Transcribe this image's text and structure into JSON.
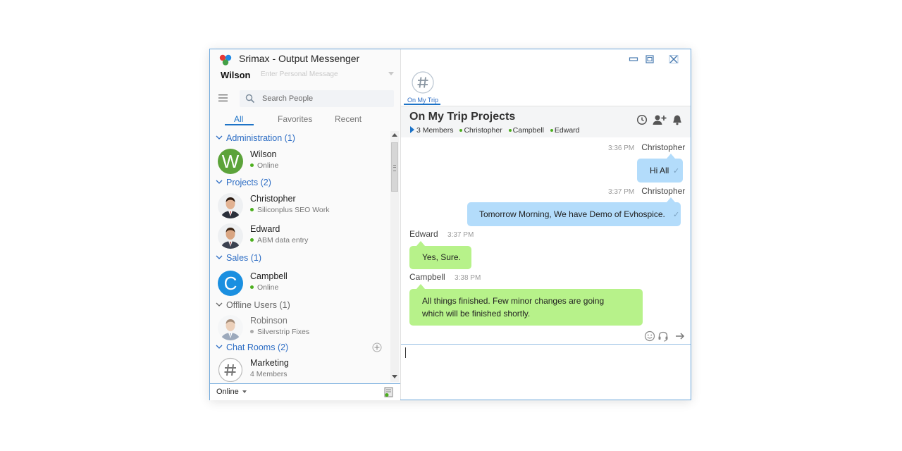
{
  "app": {
    "title": "Srimax - Output Messenger",
    "user_name": "Wilson",
    "personal_message_placeholder": "Enter Personal Message",
    "accent_color": "#1d73c7"
  },
  "search": {
    "placeholder": "Search People"
  },
  "tabs": [
    {
      "label": "All",
      "active": true
    },
    {
      "label": "Favorites",
      "active": false
    },
    {
      "label": "Recent",
      "active": false
    }
  ],
  "groups": [
    {
      "label": "Administration (1)",
      "contacts": [
        {
          "name": "Wilson",
          "status": "Online",
          "avatar_letter": "W",
          "avatar_color": "#5ca33a"
        }
      ]
    },
    {
      "label": "Projects (2)",
      "contacts": [
        {
          "name": "Christopher",
          "status": "Siliconplus SEO Work"
        },
        {
          "name": "Edward",
          "status": "ABM data entry"
        }
      ]
    },
    {
      "label": "Sales (1)",
      "contacts": [
        {
          "name": "Campbell",
          "status": "Online",
          "avatar_letter": "C",
          "avatar_color": "#1a8fe0"
        }
      ]
    },
    {
      "label": "Offline Users (1)",
      "contacts": [
        {
          "name": "Robinson",
          "status": "Silverstrip Fixes"
        }
      ]
    },
    {
      "label": "Chat Rooms (2)",
      "contacts": [
        {
          "name": "Marketing",
          "status": "4 Members"
        }
      ]
    }
  ],
  "status_bar": {
    "status": "Online"
  },
  "room_tab": {
    "label": "On My Trip"
  },
  "chat": {
    "title": "On My Trip Projects",
    "members_count": "3 Members",
    "members": [
      "Christopher",
      "Campbell",
      "Edward"
    ],
    "messages": [
      {
        "sender": "Christopher",
        "time": "3:36 PM",
        "text": "Hi All",
        "side": "right"
      },
      {
        "sender": "Christopher",
        "time": "3:37 PM",
        "text": "Tomorrow Morning, We have Demo of Evhospice.",
        "side": "right"
      },
      {
        "sender": "Edward",
        "time": "3:37 PM",
        "text": "Yes, Sure.",
        "side": "left"
      },
      {
        "sender": "Campbell",
        "time": "3:38 PM",
        "text_line1": "All things finished. Few minor changes are going",
        "text_line2": "which will be finished shortly.",
        "side": "left"
      }
    ],
    "bubble_blue": "#b3dcfb",
    "bubble_green": "#b7f28a"
  }
}
